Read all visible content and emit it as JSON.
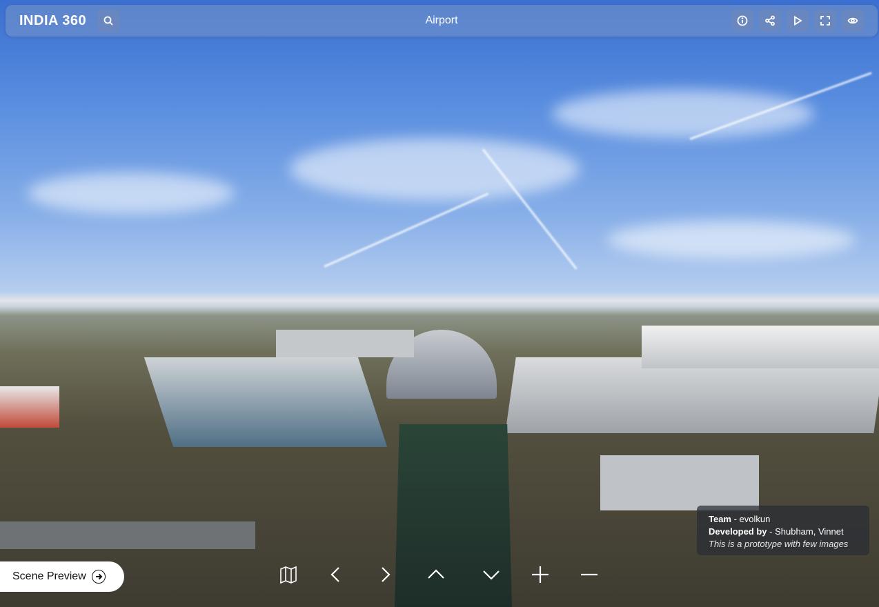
{
  "app": {
    "brand": "INDIA 360",
    "scene_title": "Airport"
  },
  "toolbar": {
    "search_icon": "search-icon",
    "right_icons": [
      "info-icon",
      "share-icon",
      "play-icon",
      "fullscreen-icon",
      "eye-icon"
    ]
  },
  "info_panel": {
    "team_label": "Team",
    "team_value": " - evolkun",
    "dev_label": "Developed by",
    "dev_value": " - Shubham, Vinnet",
    "note": "This is a prototype with few images"
  },
  "preview": {
    "label": "Scene Preview"
  },
  "controls": [
    "map-icon",
    "arrow-left-icon",
    "arrow-right-icon",
    "arrow-up-icon",
    "arrow-down-icon",
    "zoom-in-icon",
    "zoom-out-icon"
  ],
  "colors": {
    "topbar": "#7896c8",
    "panel": "#282c34",
    "sky": "#5b8fe0"
  }
}
